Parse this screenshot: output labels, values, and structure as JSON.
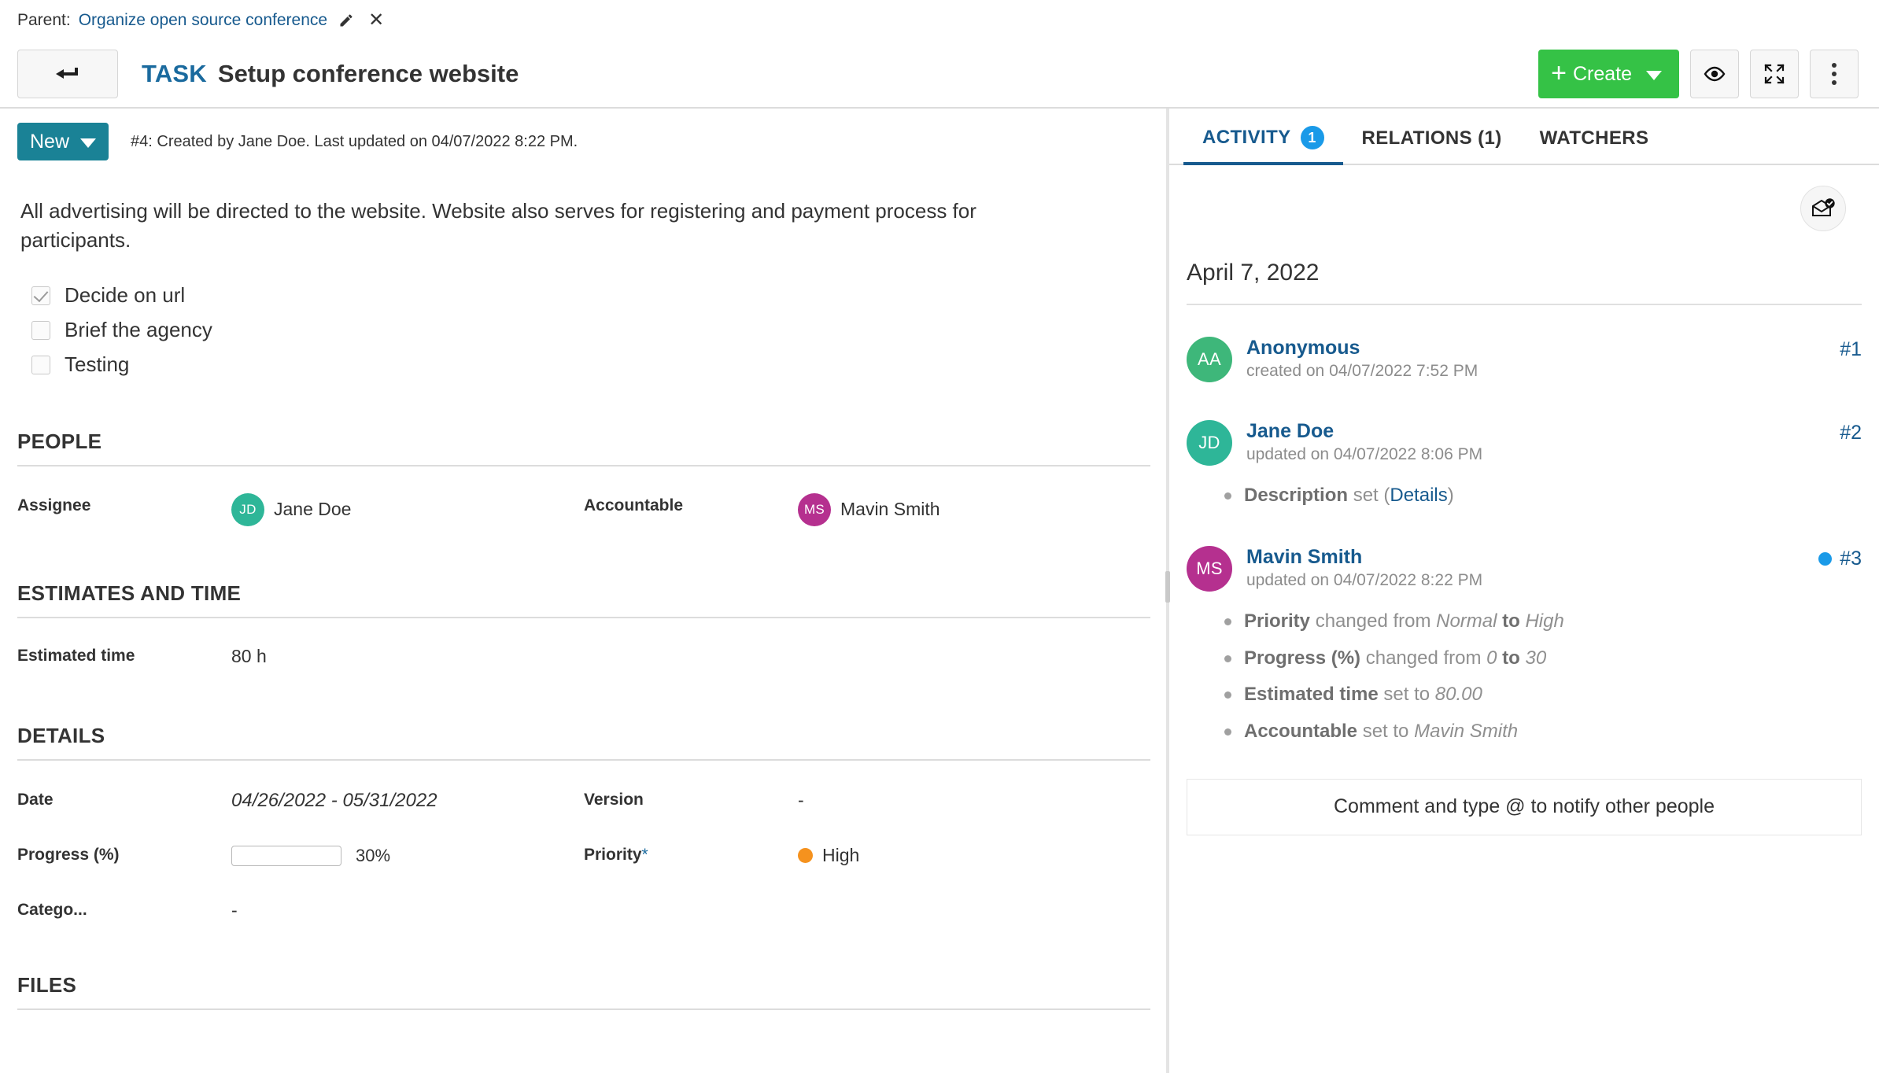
{
  "parent": {
    "label": "Parent:",
    "link_text": "Organize open source conference",
    "edit_icon": "pencil-icon",
    "remove_icon": "close-icon"
  },
  "header": {
    "back_icon": "back-arrow-icon",
    "type": "TASK",
    "subject": "Setup conference website",
    "create_label": "Create",
    "watch_icon": "eye-icon",
    "fullscreen_icon": "fullscreen-icon",
    "more_icon": "kebab-menu-icon"
  },
  "status": {
    "value": "New",
    "meta": "#4: Created by Jane Doe. Last updated on 04/07/2022 8:22 PM."
  },
  "description": {
    "text": "All advertising will be directed to the website. Website also serves for registering and payment process for participants.",
    "checklist": [
      {
        "label": "Decide on url",
        "checked": true
      },
      {
        "label": "Brief the agency",
        "checked": false
      },
      {
        "label": "Testing",
        "checked": false
      }
    ]
  },
  "sections": {
    "people": {
      "title": "PEOPLE",
      "assignee_label": "Assignee",
      "assignee_name": "Jane Doe",
      "assignee_initials": "JD",
      "assignee_color": "#2eb698",
      "accountable_label": "Accountable",
      "accountable_name": "Mavin Smith",
      "accountable_initials": "MS",
      "accountable_color": "#b5308f"
    },
    "estimates": {
      "title": "ESTIMATES AND TIME",
      "estimated_time_label": "Estimated time",
      "estimated_time_value": "80 h"
    },
    "details": {
      "title": "DETAILS",
      "date_label": "Date",
      "date_value": "04/26/2022 - 05/31/2022",
      "version_label": "Version",
      "version_value": "-",
      "progress_label": "Progress (%)",
      "progress_value": 30,
      "progress_text": "30%",
      "priority_label": "Priority",
      "priority_required": "*",
      "priority_value": "High",
      "priority_color": "#f5921e",
      "category_label": "Catego...",
      "category_value": "-"
    },
    "files": {
      "title": "FILES"
    }
  },
  "right_panel": {
    "tabs": [
      {
        "label": "ACTIVITY",
        "count": "1",
        "active": true
      },
      {
        "label": "RELATIONS (1)",
        "count": null,
        "active": false
      },
      {
        "label": "WATCHERS",
        "count": null,
        "active": false
      }
    ],
    "mark_read_icon": "mark-all-read-icon",
    "date_group": "April 7, 2022",
    "entries": [
      {
        "initials": "AA",
        "avatar_color": "#3eb77a",
        "user": "Anonymous",
        "time": "created on 04/07/2022 7:52 PM",
        "number": "#1",
        "unread": false,
        "details": []
      },
      {
        "initials": "JD",
        "avatar_color": "#2eb698",
        "user": "Jane Doe",
        "time": "updated on 04/07/2022 8:06 PM",
        "number": "#2",
        "unread": false,
        "details": [
          {
            "field": "Description",
            "action": " set (",
            "value": "Details",
            "value_style": "link",
            "suffix": ")"
          }
        ]
      },
      {
        "initials": "MS",
        "avatar_color": "#b5308f",
        "user": "Mavin Smith",
        "time": "updated on 04/07/2022 8:22 PM",
        "number": "#3",
        "unread": true,
        "details": [
          {
            "field": "Priority",
            "action": " changed from ",
            "value": "Normal",
            "value_style": "italic",
            "mid": " to ",
            "value2": "High"
          },
          {
            "field": "Progress (%)",
            "action": " changed from ",
            "value": "0",
            "value_style": "italic",
            "mid": " to ",
            "value2": "30"
          },
          {
            "field": "Estimated time",
            "action": " set to ",
            "value": "80.00",
            "value_style": "italic"
          },
          {
            "field": "Accountable",
            "action": " set to ",
            "value": "Mavin Smith",
            "value_style": "italic"
          }
        ]
      }
    ],
    "comment_placeholder": "Comment and type @ to notify other people"
  }
}
